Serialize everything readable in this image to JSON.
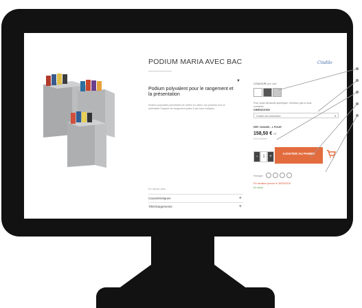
{
  "product": {
    "title": "PODIUM MARIA AVEC BAC",
    "description_heading": "Podium polyvalent pour le rangement et la présentation",
    "description_text": "Podium polyvalent permettant de mettre en valeur vos produits tout en optimisant l'espace de rangement grâce à ses bacs intégrés.",
    "more_link": "En savoir plus",
    "accordions": [
      {
        "label": "Caractéristiques"
      },
      {
        "label": "Téléchargements"
      }
    ]
  },
  "brand": {
    "logo_text": "Cindilo"
  },
  "options": {
    "color_label": "COULEUR",
    "color_selected": "gris clair",
    "swatches": [
      "#ffffff",
      "#555555",
      "#c8c8c8"
    ],
    "note": "Pour toute demande spécifique, n'hésitez pas à nous contacter.",
    "dimension_label": "DIMENSIONS",
    "dimension_value": "Choisir une dimension"
  },
  "pricing": {
    "ref": "REF. DN0495 - 1 POUR",
    "price": "158,50 €",
    "price_suffix": "HT",
    "ecotax": "Dont écotaxe"
  },
  "cart": {
    "qty": "1",
    "minus": "−",
    "plus": "+",
    "add_label": "AJOUTER AU PANIER"
  },
  "share": {
    "label": "Partager"
  },
  "availability": {
    "delivery": "Fin livraison prévue le 30/04/2019",
    "stock": "En stock"
  },
  "colors": {
    "accent": "#e36c3e",
    "bezel": "#121212"
  }
}
